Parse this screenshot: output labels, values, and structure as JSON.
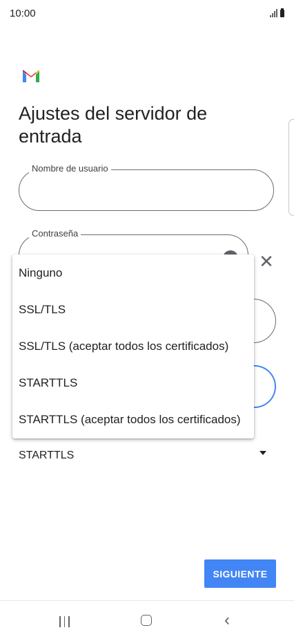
{
  "status_bar": {
    "time": "10:00"
  },
  "page": {
    "title": "Ajustes del servidor de entrada"
  },
  "fields": {
    "username": {
      "label": "Nombre de usuario",
      "value": ""
    },
    "password": {
      "label": "Contraseña",
      "value": ""
    }
  },
  "security": {
    "selected": "STARTTLS"
  },
  "dropdown": {
    "options": [
      "Ninguno",
      "SSL/TLS",
      "SSL/TLS (aceptar todos los certificados)",
      "STARTTLS",
      "STARTTLS (aceptar todos los certificados)"
    ]
  },
  "actions": {
    "next_label": "SIGUIENTE"
  },
  "icons": {
    "logo": "gmail-logo",
    "close": "close-icon",
    "caret": "caret-down-icon",
    "eye": "visibility-icon"
  },
  "colors": {
    "accent": "#4285f4",
    "text": "#202124"
  }
}
